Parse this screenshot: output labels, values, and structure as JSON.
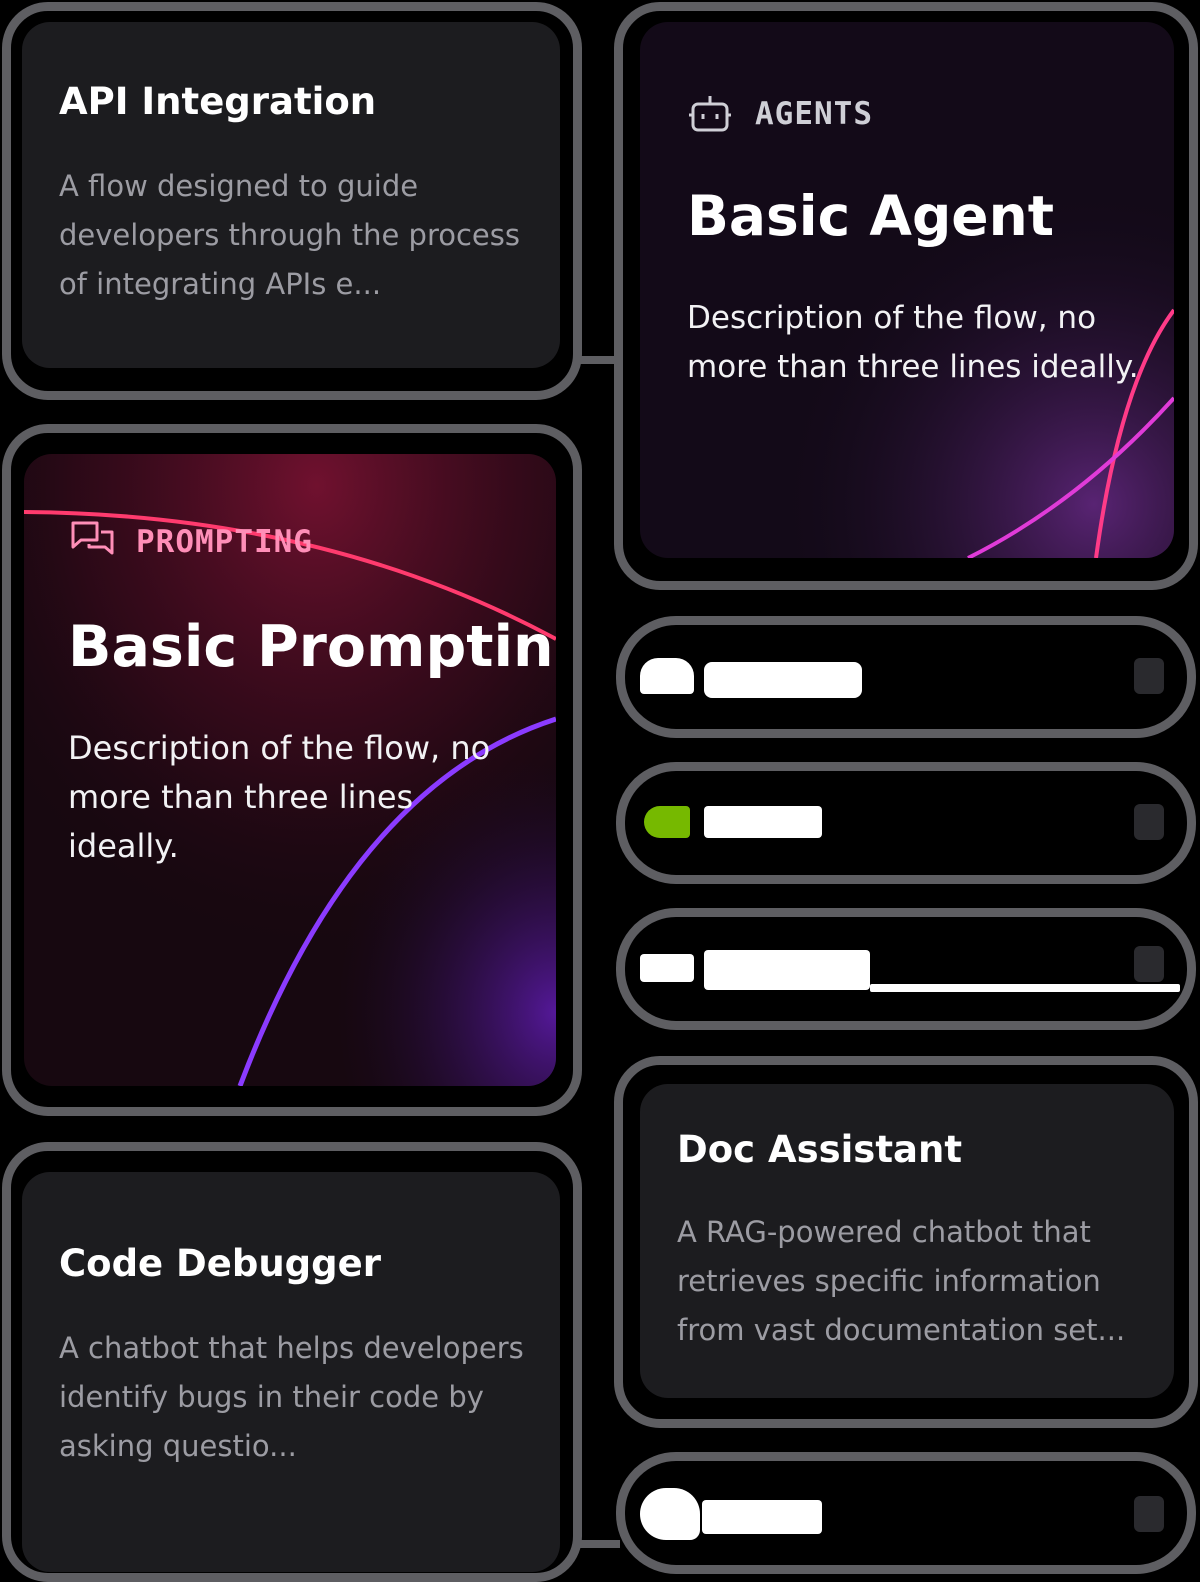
{
  "cards": {
    "api_integration": {
      "title": "API Integration",
      "description": "A flow designed to guide developers through the process of integrating APIs e..."
    },
    "basic_prompting": {
      "tag": "PROMPTING",
      "title": "Basic Prompting",
      "description": "Description of the flow, no more than three lines ideally.",
      "tag_icon": "chat-bubbles-icon",
      "accent": "#ff5c9a"
    },
    "code_debugger": {
      "title": "Code Debugger",
      "description": "A chatbot that helps developers identify bugs in their code by asking questio..."
    },
    "basic_agent": {
      "tag": "AGENTS",
      "title": "Basic Agent",
      "description": "Description of the flow, no more than three lines ideally.",
      "tag_icon": "robot-icon",
      "accent": "#cfcfd6"
    },
    "doc_assistant": {
      "title": "Doc Assistant",
      "description": "A RAG-powered chatbot that retrieves specific information from vast documentation set..."
    }
  },
  "integrations": [
    {
      "icon": "cloud-logo-icon",
      "color": "#ffffff"
    },
    {
      "icon": "nvidia-logo-icon",
      "color": "#76b900"
    },
    {
      "icon": "brand-logo-icon",
      "color": "#ffffff"
    },
    {
      "icon": "brand-logo-icon",
      "color": "#ffffff"
    }
  ]
}
